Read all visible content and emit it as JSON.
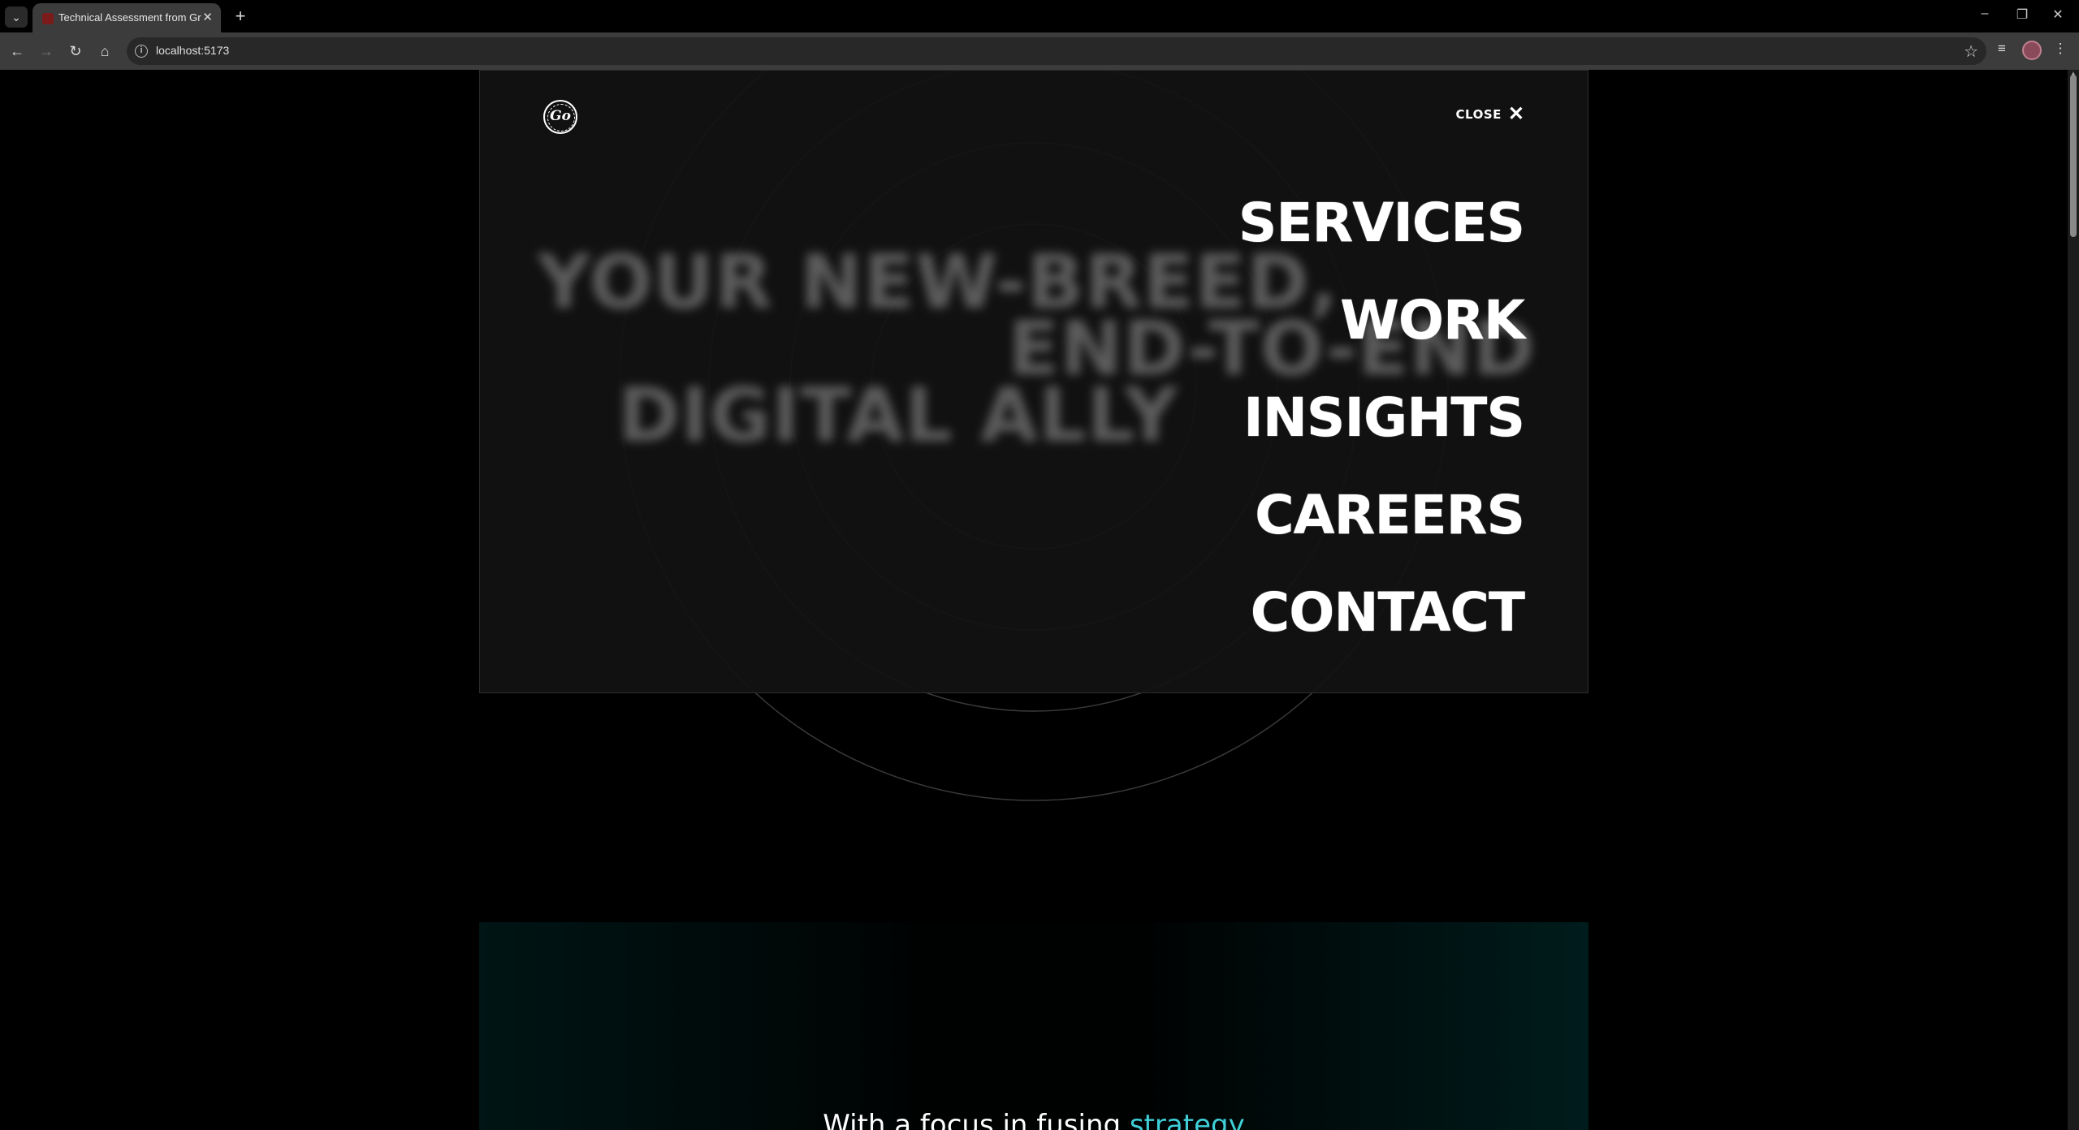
{
  "browser": {
    "tab_title": "Technical Assessment from Gro",
    "url": "localhost:5173",
    "icons": {
      "tab_list": "chevron-down-icon",
      "tab_close": "close-icon",
      "new_tab": "plus-icon",
      "back": "arrow-left-icon",
      "forward": "arrow-right-icon",
      "reload": "reload-icon",
      "home": "home-icon",
      "site_info": "info-icon",
      "bookmark": "star-icon",
      "media": "media-control-icon",
      "profile": "avatar",
      "menu": "kebab-menu-icon",
      "minimize": "minimize-icon",
      "maximize": "restore-icon",
      "close_window": "close-window-icon"
    }
  },
  "menu": {
    "close_label": "CLOSE",
    "items": [
      "SERVICES",
      "WORK",
      "INSIGHTS",
      "CAREERS",
      "CONTACT"
    ]
  },
  "hero": {
    "line1": "YOUR NEW-BREED,",
    "line2": "END-TO-END",
    "line3": "DIGITAL ALLY"
  },
  "tagline": {
    "prefix": "With a focus in fusing ",
    "accent": "strategy"
  },
  "colors": {
    "background": "#000000",
    "accent": "#3fd0d8",
    "text": "#ffffff"
  }
}
